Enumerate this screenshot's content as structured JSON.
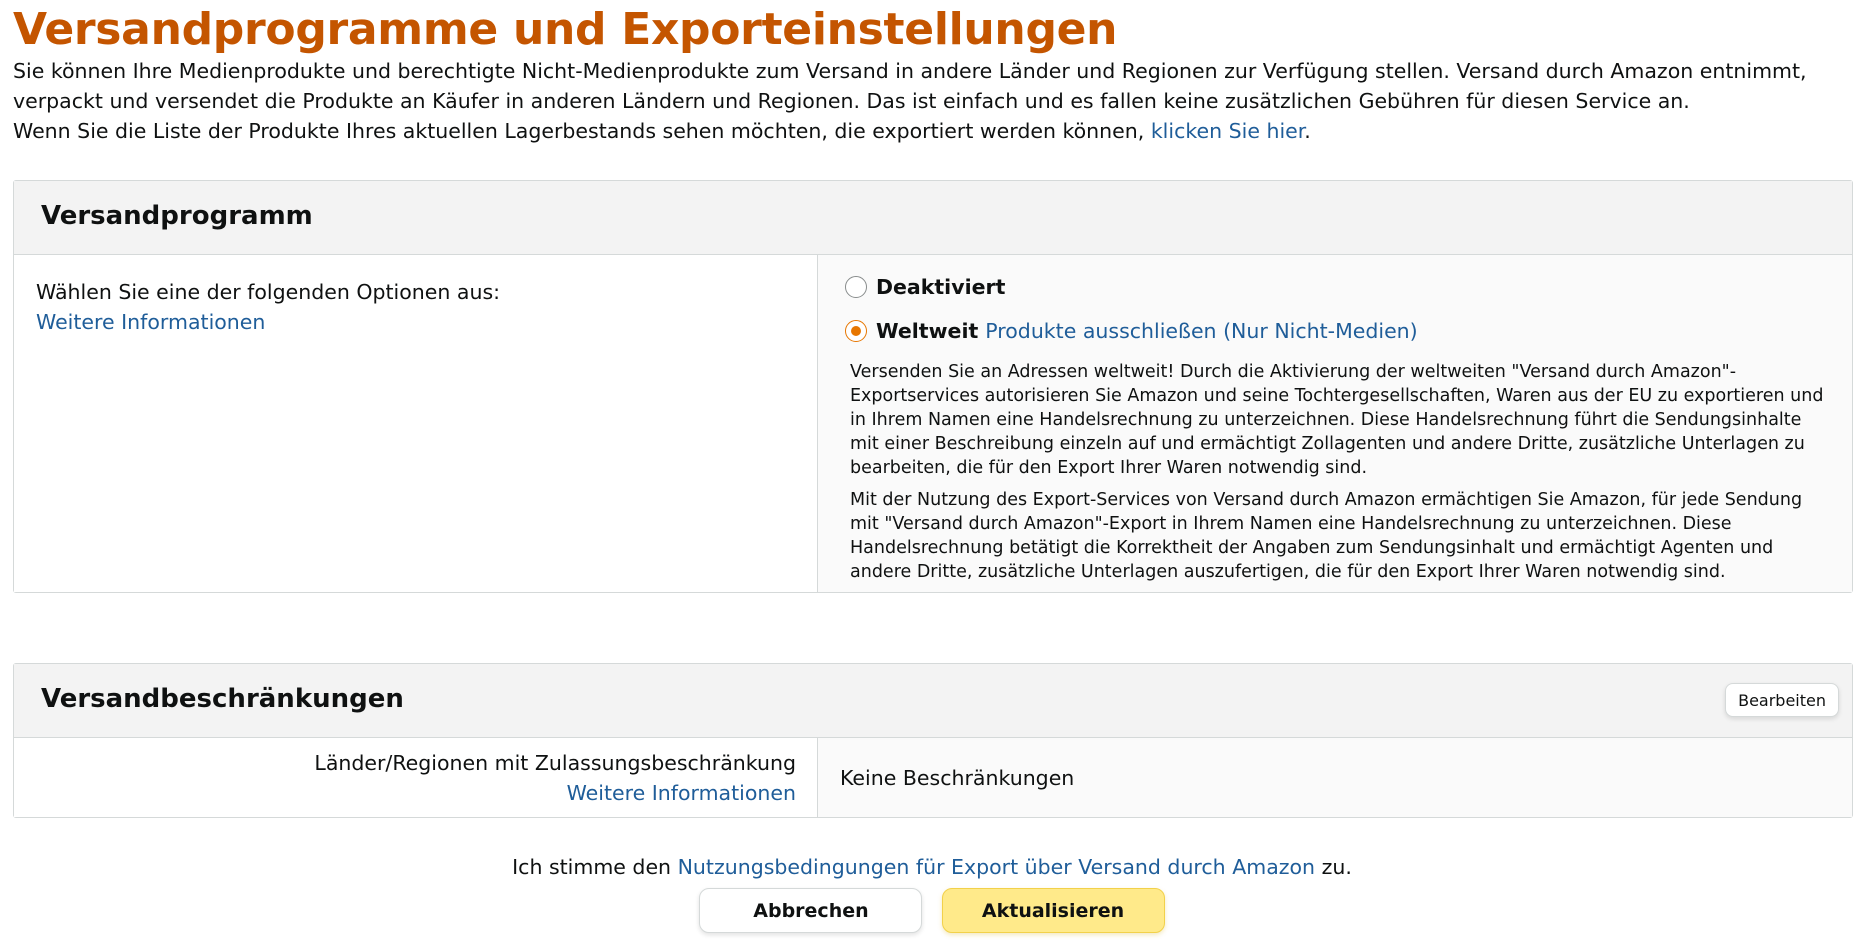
{
  "page": {
    "title": "Versandprogramme und Exporteinstellungen",
    "intro_line1": "Sie können Ihre Medienprodukte und berechtigte Nicht-Medienprodukte zum Versand in andere Länder und Regionen zur Verfügung stellen. Versand durch Amazon entnimmt, verpackt und versendet die Produkte an Käufer in anderen Ländern und Regionen. Das ist einfach und es fallen keine zusätzlichen Gebühren für diesen Service an.",
    "intro_line2_text": "Wenn Sie die Liste der Produkte Ihres aktuellen Lagerbestands sehen möchten, die exportiert werden können,",
    "intro_line2_link": "klicken Sie hier",
    "intro_line2_end": "."
  },
  "program": {
    "heading": "Versandprogramm",
    "prompt": "Wählen Sie eine der folgenden Optionen aus:",
    "more_info": "Weitere Informationen",
    "option_disabled": "Deaktiviert",
    "option_worldwide": "Weltweit",
    "exclude_link": "Produkte ausschließen (Nur Nicht-Medien)",
    "selected": "Weltweit",
    "desc1": "Versenden Sie an Adressen weltweit! Durch die Aktivierung der weltweiten \"Versand durch Amazon\"-Exportservices autorisieren Sie Amazon und seine Tochtergesellschaften, Waren aus der EU zu exportieren und in Ihrem Namen eine Handelsrechnung zu unterzeichnen. Diese Handelsrechnung führt die Sendungsinhalte mit einer Beschreibung einzeln auf und ermächtigt Zollagenten und andere Dritte, zusätzliche Unterlagen zu bearbeiten, die für den Export Ihrer Waren notwendig sind.",
    "desc2": "Mit der Nutzung des Export-Services von Versand durch Amazon ermächtigen Sie Amazon, für jede Sendung mit \"Versand durch Amazon\"-Export in Ihrem Namen eine Handelsrechnung zu unterzeichnen. Diese Handelsrechnung betätigt die Korrektheit der Angaben zum Sendungsinhalt und ermächtigt Agenten und andere Dritte, zusätzliche Unterlagen auszufertigen, die für den Export Ihrer Waren notwendig sind."
  },
  "restrictions": {
    "heading": "Versandbeschränkungen",
    "edit_button": "Bearbeiten",
    "label": "Länder/Regionen mit Zulassungsbeschränkung",
    "more_info": "Weitere Informationen",
    "value": "Keine Beschränkungen"
  },
  "footer": {
    "agree_prefix": "Ich stimme den",
    "agree_link": "Nutzungsbedingungen für Export über Versand durch Amazon",
    "agree_suffix": "zu.",
    "cancel_button": "Abbrechen",
    "update_button": "Aktualisieren"
  },
  "colors": {
    "title": "#c45500",
    "link": "#1f5d99",
    "radio_selected": "#e77600",
    "primary_button": "#ffea8a"
  }
}
